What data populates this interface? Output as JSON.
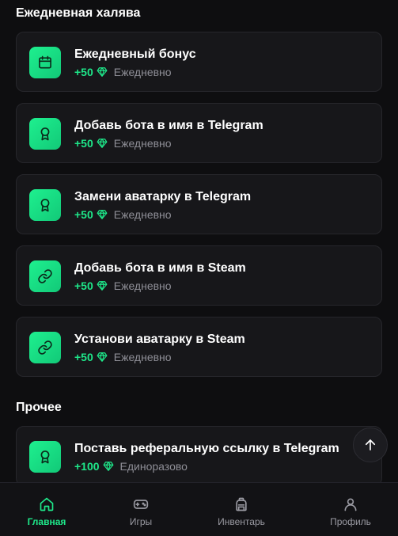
{
  "sections": {
    "daily_title": "Ежедневная халява",
    "other_title": "Прочее"
  },
  "colors": {
    "accent": "#1ee88a",
    "background": "#0e0e10",
    "card": "#17171a"
  },
  "daily_tasks": [
    {
      "title": "Ежедневный бонус",
      "reward": "+50",
      "frequency": "Ежедневно",
      "icon": "calendar-icon"
    },
    {
      "title": "Добавь бота в имя в Telegram",
      "reward": "+50",
      "frequency": "Ежедневно",
      "icon": "award-icon"
    },
    {
      "title": "Замени аватарку в Telegram",
      "reward": "+50",
      "frequency": "Ежедневно",
      "icon": "award-icon"
    },
    {
      "title": "Добавь бота в имя в Steam",
      "reward": "+50",
      "frequency": "Ежедневно",
      "icon": "link-icon"
    },
    {
      "title": "Установи аватарку в Steam",
      "reward": "+50",
      "frequency": "Ежедневно",
      "icon": "link-icon"
    }
  ],
  "other_tasks": [
    {
      "title": "Поставь реферальную ссылку в Telegram",
      "reward": "+100",
      "frequency": "Единоразово",
      "icon": "award-icon"
    }
  ],
  "nav": [
    {
      "label": "Главная",
      "icon": "home-icon",
      "active": true
    },
    {
      "label": "Игры",
      "icon": "gamepad-icon",
      "active": false
    },
    {
      "label": "Инвентарь",
      "icon": "backpack-icon",
      "active": false
    },
    {
      "label": "Профиль",
      "icon": "user-icon",
      "active": false
    }
  ],
  "scroll_top_icon": "arrow-up-icon"
}
